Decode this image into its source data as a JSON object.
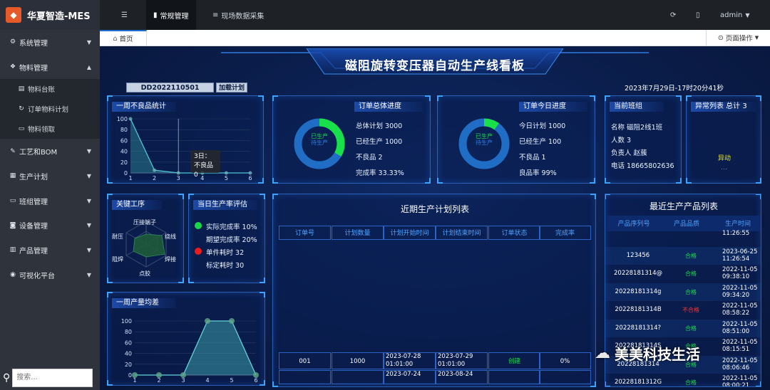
{
  "app": {
    "title": "华夏智造-MES"
  },
  "topbar": {
    "tabs": [
      {
        "label": "常规管理",
        "icon": "home-icon"
      },
      {
        "label": "现场数据采集",
        "icon": "database-icon"
      }
    ],
    "user": "admin"
  },
  "sidebar": {
    "items": [
      {
        "label": "系统管理",
        "icon": "gears-icon"
      },
      {
        "label": "物料管理",
        "icon": "cubes-icon"
      },
      {
        "label": "工艺和BOM",
        "icon": "wrench-icon"
      },
      {
        "label": "生产计划",
        "icon": "calendar-icon"
      },
      {
        "label": "班组管理",
        "icon": "monitor-icon"
      },
      {
        "label": "设备管理",
        "icon": "device-icon"
      },
      {
        "label": "产品管理",
        "icon": "bar-chart-icon"
      },
      {
        "label": "可视化平台",
        "icon": "camera-icon"
      }
    ],
    "subitems": [
      {
        "label": "物料台账",
        "icon": "book-icon"
      },
      {
        "label": "订单物料计划",
        "icon": "refresh-icon"
      },
      {
        "label": "物料领取",
        "icon": "file-icon"
      }
    ],
    "search_placeholder": "搜索..."
  },
  "tabsbar": {
    "home": "首页",
    "page_ops": "页面操作"
  },
  "dashboard": {
    "title": "磁阻旋转变压器自动生产线看板",
    "plan_input": "DD2022110501",
    "load_plan": "加载计划",
    "datetime": "2023年7月29日-17时20分41秒",
    "weekly_defects": {
      "title": "一周不良品统计",
      "tooltip_line1": "3日：",
      "tooltip_line2": "不良品0"
    },
    "order_total": {
      "title": "订单总体进度",
      "donut_label1": "已生产",
      "donut_label2": "待生产",
      "lines": [
        "总体计划 3000",
        "已经生产 1000",
        "不良品 2",
        "完成率 33.33%"
      ],
      "progress": 0.3333
    },
    "order_today": {
      "title": "订单今日进度",
      "donut_label1": "已生产",
      "donut_label2": "待生产",
      "lines": [
        "今日计划 1000",
        "已经生产 100",
        "不良品 1",
        "良品率 99%"
      ],
      "progress": 0.1
    },
    "shift": {
      "title": "当前班组",
      "lines": [
        "名称 磁阻2线1班",
        "人数 3",
        "负责人 赵蔟",
        "电话 18665802636"
      ]
    },
    "anomaly": {
      "title": "异常列表 总计 3",
      "item": "异动",
      "more": "…"
    },
    "key_process": {
      "title": "关键工序",
      "axes": [
        "压接端子",
        "绕线",
        "焊接",
        "点胶",
        "阻焊",
        "耐压"
      ]
    },
    "daily_rate": {
      "title": "当日生产率评估",
      "lines": [
        "实际完成率 10%",
        "期望完成率 20%",
        "单件耗时 32",
        "标定耗时 30"
      ],
      "colors": [
        "#18d84a",
        "#e81c1c"
      ]
    },
    "weekly_variance": {
      "title": "一周产量均差"
    },
    "plan_list": {
      "title": "近期生产计划列表",
      "headers": [
        "订单号",
        "计划数量",
        "计划开始时间",
        "计划结束时间",
        "订单状态",
        "完成率"
      ],
      "rows": [
        [
          "001",
          "1000",
          "2023-07-28 01:01:00",
          "2023-07-29 01:01:00",
          "创建",
          "0%"
        ],
        [
          "",
          "",
          "2023-07-24",
          "2023-08-24",
          "",
          ""
        ]
      ]
    },
    "recent_products": {
      "title": "最近生产产品列表",
      "headers": [
        "产品序列号",
        "产品品质",
        "生产时间"
      ],
      "rows": [
        [
          "",
          "",
          "11:26:55"
        ],
        [
          "123456",
          "合格",
          "2023-06-25 11:26:54"
        ],
        [
          "20228181314@",
          "合格",
          "2022-11-05 09:38:10"
        ],
        [
          "20228181314g",
          "合格",
          "2022-11-05 09:34:20"
        ],
        [
          "20228181314B",
          "不合格",
          "2022-11-05 08:58:22"
        ],
        [
          "20228181314?",
          "合格",
          "2022-11-05 08:51:00"
        ],
        [
          "20228181314S",
          "合格",
          "2022-11-05 08:15:51"
        ],
        [
          "20228181314",
          "合格",
          "2022-11-05 08:06:46"
        ],
        [
          "20228181312G",
          "合格",
          "2022-11-05 08:00:21"
        ]
      ]
    },
    "watermark": "美美科技生活"
  },
  "chart_data": [
    {
      "type": "area",
      "title": "一周不良品统计",
      "x": [
        1,
        2,
        3,
        4,
        5,
        6
      ],
      "y": [
        100,
        5,
        0,
        0,
        0,
        0
      ],
      "ylim": [
        0,
        100
      ],
      "yticks": [
        0,
        20,
        40,
        60,
        80,
        100
      ]
    },
    {
      "type": "area",
      "title": "一周产量均差",
      "x": [
        1,
        2,
        3,
        4,
        5,
        6
      ],
      "y": [
        0,
        0,
        0,
        100,
        100,
        0
      ],
      "ylim": [
        0,
        100
      ],
      "yticks": [
        0,
        20,
        40,
        60,
        80,
        100
      ]
    },
    {
      "type": "pie",
      "title": "订单总体进度",
      "values": [
        33.33,
        66.67
      ]
    },
    {
      "type": "pie",
      "title": "订单今日进度",
      "values": [
        10,
        90
      ]
    }
  ]
}
